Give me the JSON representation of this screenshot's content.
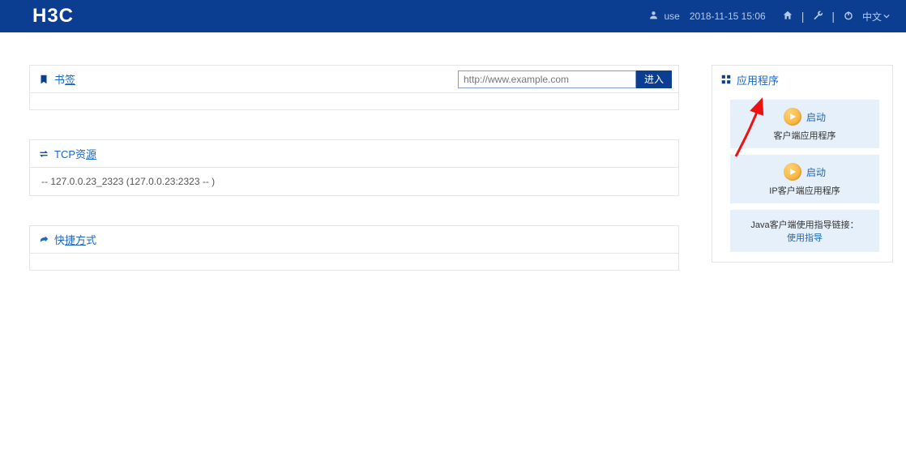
{
  "header": {
    "logo": "H3C",
    "user_name": "use",
    "timestamp": "2018-11-15 15:06",
    "lang": "中文"
  },
  "bookmarks": {
    "title_prefix_a": "书",
    "title_suffix_a": "签",
    "url_placeholder": "http://www.example.com",
    "go_label": "进入"
  },
  "tcp": {
    "title_prefix": "TCP资",
    "title_suffix": "源",
    "item": "-- 127.0.0.23_2323 (127.0.0.23:2323 --                        )"
  },
  "shortcuts": {
    "title_prefix": "快",
    "title_mid": "捷方",
    "title_suffix": "式"
  },
  "apps": {
    "title": "应用程序",
    "launch_label": "启动",
    "card1_desc": "客户端应用程序",
    "card2_desc": "IP客户端应用程序",
    "guide_label": "Java客户端使用指导链接：",
    "guide_link": "使用指导"
  }
}
